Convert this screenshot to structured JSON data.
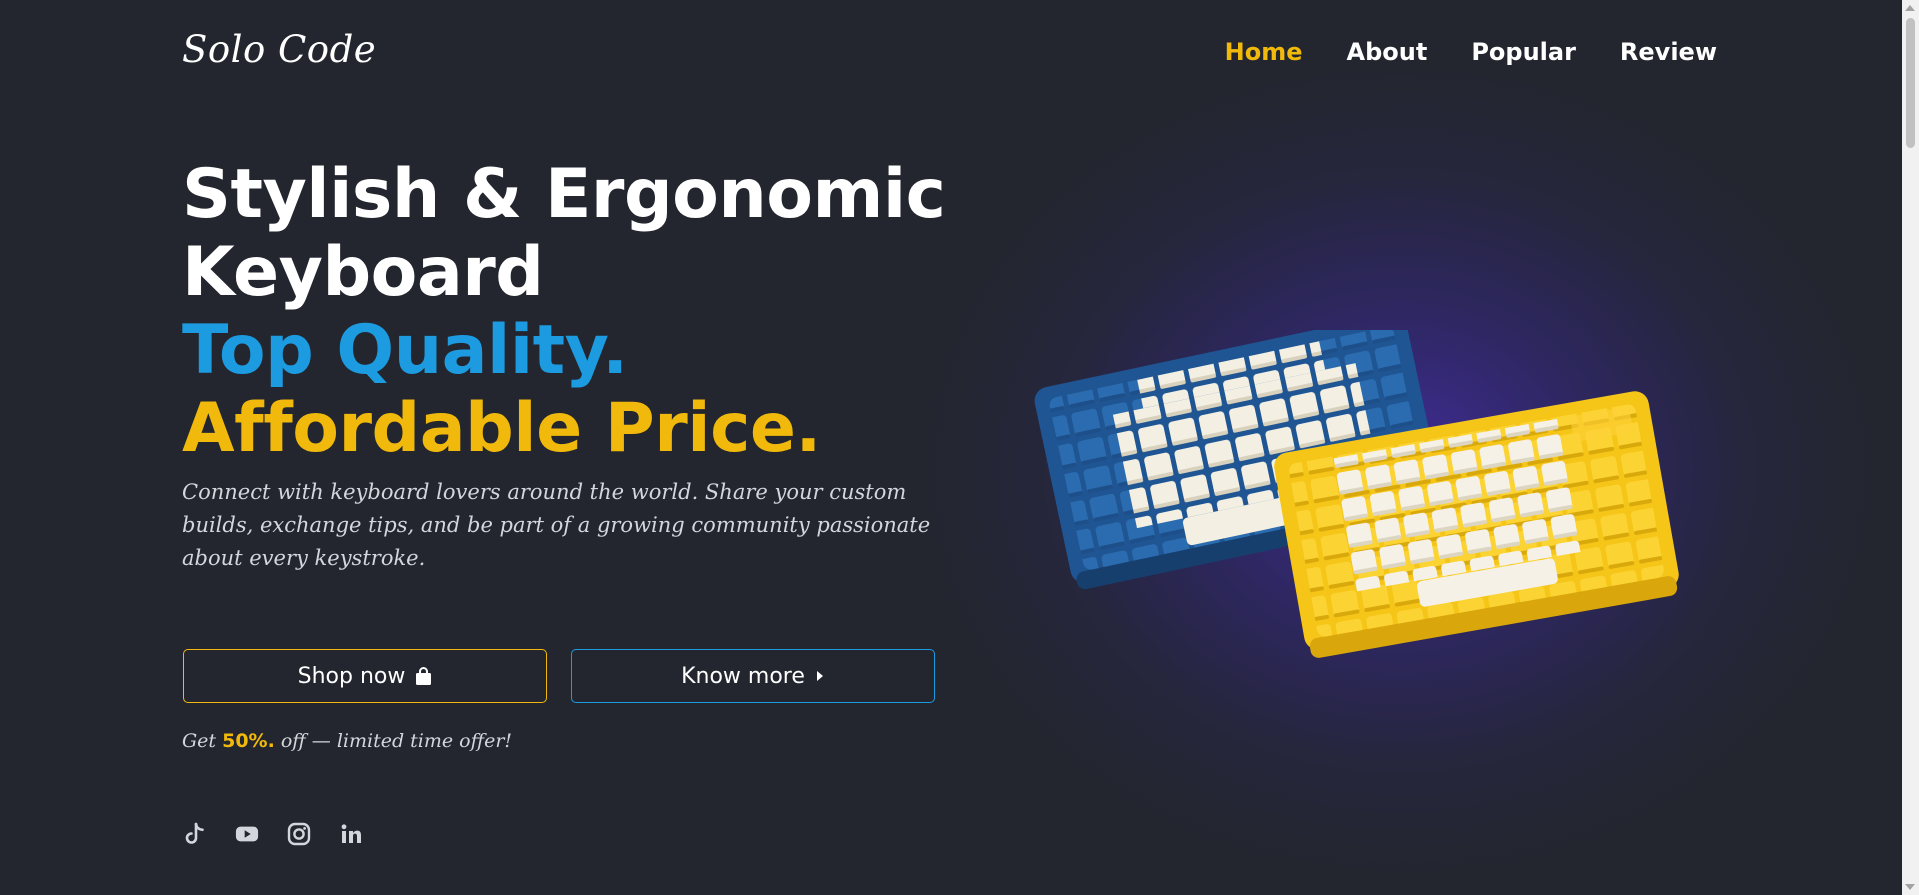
{
  "header": {
    "logo": "Solo Code",
    "nav": [
      {
        "label": "Home",
        "active": true
      },
      {
        "label": "About",
        "active": false
      },
      {
        "label": "Popular",
        "active": false
      },
      {
        "label": "Review",
        "active": false
      }
    ]
  },
  "hero": {
    "title_line1": "Stylish & Ergonomic",
    "title_line2": "Keyboard",
    "title_line3": "Top Quality.",
    "title_line4": "Affordable Price.",
    "description": "Connect with keyboard lovers around the world. Share your custom builds, exchange tips, and be part of a growing community passionate about every keystroke.",
    "shop_button": "Shop now",
    "know_button": "Know more",
    "offer_prefix": "Get",
    "offer_percent": "50%.",
    "offer_suffix": "off — limited time offer!"
  },
  "socials": [
    {
      "icon": "tiktok-icon"
    },
    {
      "icon": "youtube-icon"
    },
    {
      "icon": "instagram-icon"
    },
    {
      "icon": "linkedin-icon"
    }
  ],
  "image": {
    "subject": "two mechanical keyboards (blue and yellow)"
  },
  "colors": {
    "background": "#23262f",
    "accent_yellow": "#f0b90b",
    "accent_blue": "#1d9be0",
    "text": "#ffffff",
    "muted_text": "#d4d6de",
    "glow": "#462daa"
  }
}
